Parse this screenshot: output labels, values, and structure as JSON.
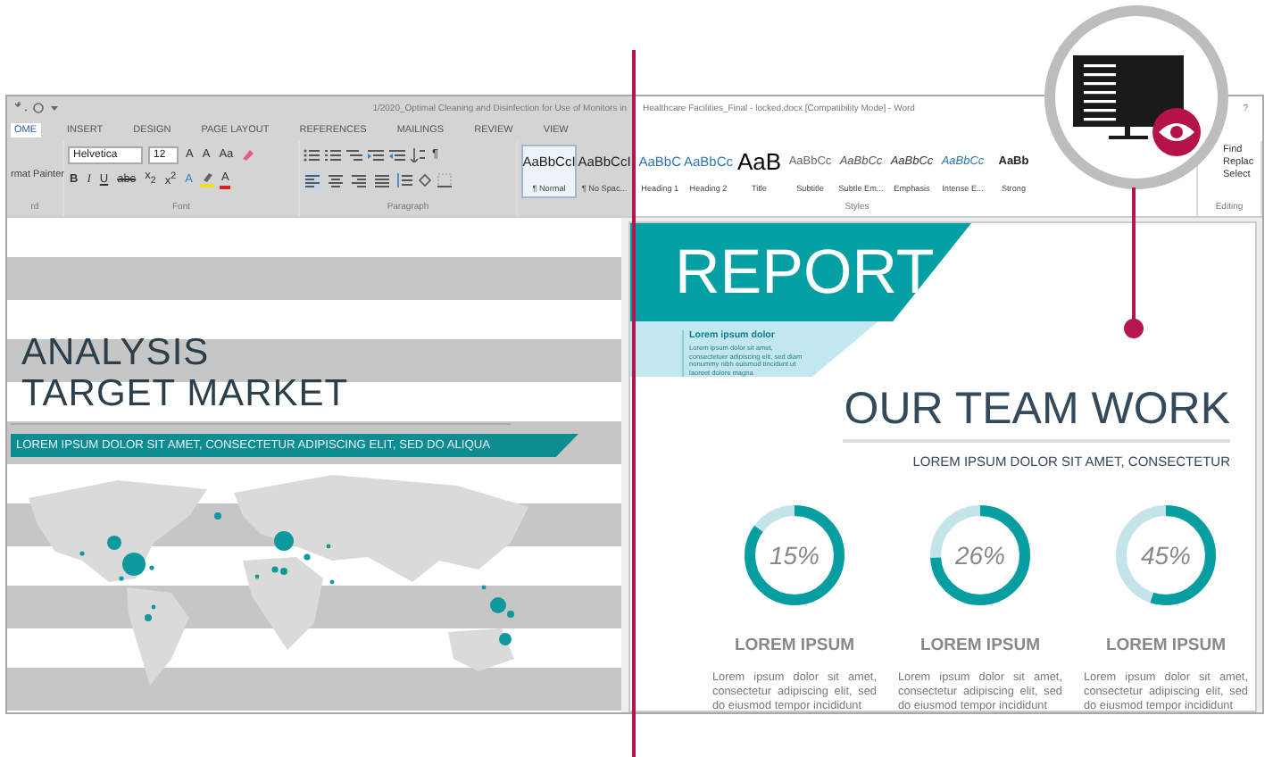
{
  "window": {
    "title_parts": [
      "1/2020_Optimal Cleaning and Disinfection for Use of Monitors in",
      "Healthcare Facilities_Final - locked.docx [Compatibility Mode] - Word"
    ],
    "help": "?"
  },
  "tabs": [
    {
      "label": "OME",
      "selected": true
    },
    {
      "label": "INSERT",
      "selected": false
    },
    {
      "label": "DESIGN",
      "selected": false
    },
    {
      "label": "PAGE LAYOUT",
      "selected": false
    },
    {
      "label": "REFERENCES",
      "selected": false
    },
    {
      "label": "MAILINGS",
      "selected": false
    },
    {
      "label": "REVIEW",
      "selected": false
    },
    {
      "label": "VIEW",
      "selected": false
    }
  ],
  "ribbon": {
    "clipboard": {
      "format_painter": "rmat Painter",
      "label": "rd"
    },
    "font": {
      "name": "Helvetica",
      "size": "12",
      "row1": [
        "A",
        "A",
        "Aa"
      ],
      "row2": [
        {
          "label": "B",
          "kind": "bold"
        },
        {
          "label": "I",
          "kind": "italic"
        },
        {
          "label": "U",
          "kind": "underline"
        },
        {
          "label": "abc",
          "kind": "strike"
        },
        {
          "label": "x$_{2}$",
          "kind": "plain"
        },
        {
          "label": "x$^{2}$",
          "kind": "plain"
        },
        {
          "label": "A",
          "kind": "effects"
        },
        {
          "kind": "highlight"
        },
        {
          "label": "A",
          "kind": "color"
        }
      ],
      "label": "Font"
    },
    "paragraph": {
      "pilcrow": "¶",
      "alignments": [
        {
          "kind": "left",
          "selected": true
        },
        {
          "kind": "center",
          "selected": false
        },
        {
          "kind": "right",
          "selected": false
        },
        {
          "kind": "justify",
          "selected": false
        }
      ],
      "label": "Paragraph"
    },
    "styles": {
      "items": [
        {
          "sample": "AaBbCcI",
          "name": "¶ Normal",
          "kind": "normal",
          "selected": true
        },
        {
          "sample": "AaBbCcI",
          "name": "¶ No Spac...",
          "kind": "normal",
          "selected": false
        },
        {
          "sample": "AaBbC",
          "name": "Heading 1",
          "kind": "heading",
          "selected": false
        },
        {
          "sample": "AaBbCc",
          "name": "Heading 2",
          "kind": "heading",
          "selected": false
        },
        {
          "sample": "AaB",
          "name": "Title",
          "kind": "title",
          "selected": false
        },
        {
          "sample": "AaBbCc",
          "name": "Subtitle",
          "kind": "subtitle",
          "selected": false
        },
        {
          "sample": "AaBbCc",
          "name": "Subtle Em...",
          "kind": "subtle",
          "selected": false
        },
        {
          "sample": "AaBbCc",
          "name": "Emphasis",
          "kind": "emphasis",
          "selected": false
        },
        {
          "sample": "AaBbCc",
          "name": "Intense E...",
          "kind": "intense",
          "selected": false
        },
        {
          "sample": "AaBb",
          "name": "Strong",
          "kind": "strong",
          "selected": false
        }
      ],
      "label": "Styles"
    },
    "editing": {
      "items": [
        "Find",
        "Replac",
        "Select"
      ],
      "label": "Editing"
    }
  },
  "document": {
    "left": {
      "title_lines": [
        "ANALYSIS",
        "TARGET MARKET"
      ],
      "banner": "LOREM IPSUM DOLOR SIT AMET, CONSECTETUR ADIPISCING ELIT, SED DO ALIQUA"
    },
    "right": {
      "report": "REPORT",
      "aside_title": "Lorem ipsum dolor",
      "aside_text": "Lorem ipsum dolor sit amet, consectetuer adipiscing elit, sed diam nonummy nibh euismod tincidunt ut laoreet dolore magna",
      "heading": "OUR TEAM WORK",
      "subheading": "LOREM IPSUM DOLOR SIT AMET, CONSECTETUR",
      "stats": [
        {
          "value": "15%",
          "level": 0.85,
          "title": "LOREM IPSUM",
          "text": "Lorem ipsum dolor sit amet, consectetur adipiscing elit, sed do eiusmod tempor incididunt"
        },
        {
          "value": "26%",
          "level": 0.74,
          "title": "LOREM IPSUM",
          "text": "Lorem ipsum dolor sit amet, consectetur adipiscing elit, sed do eiusmod tempor incididunt"
        },
        {
          "value": "45%",
          "level": 0.55,
          "title": "LOREM IPSUM",
          "text": "Lorem ipsum dolor sit amet, consectetur adipiscing elit, sed do eiusmod tempor incididunt"
        }
      ]
    }
  }
}
